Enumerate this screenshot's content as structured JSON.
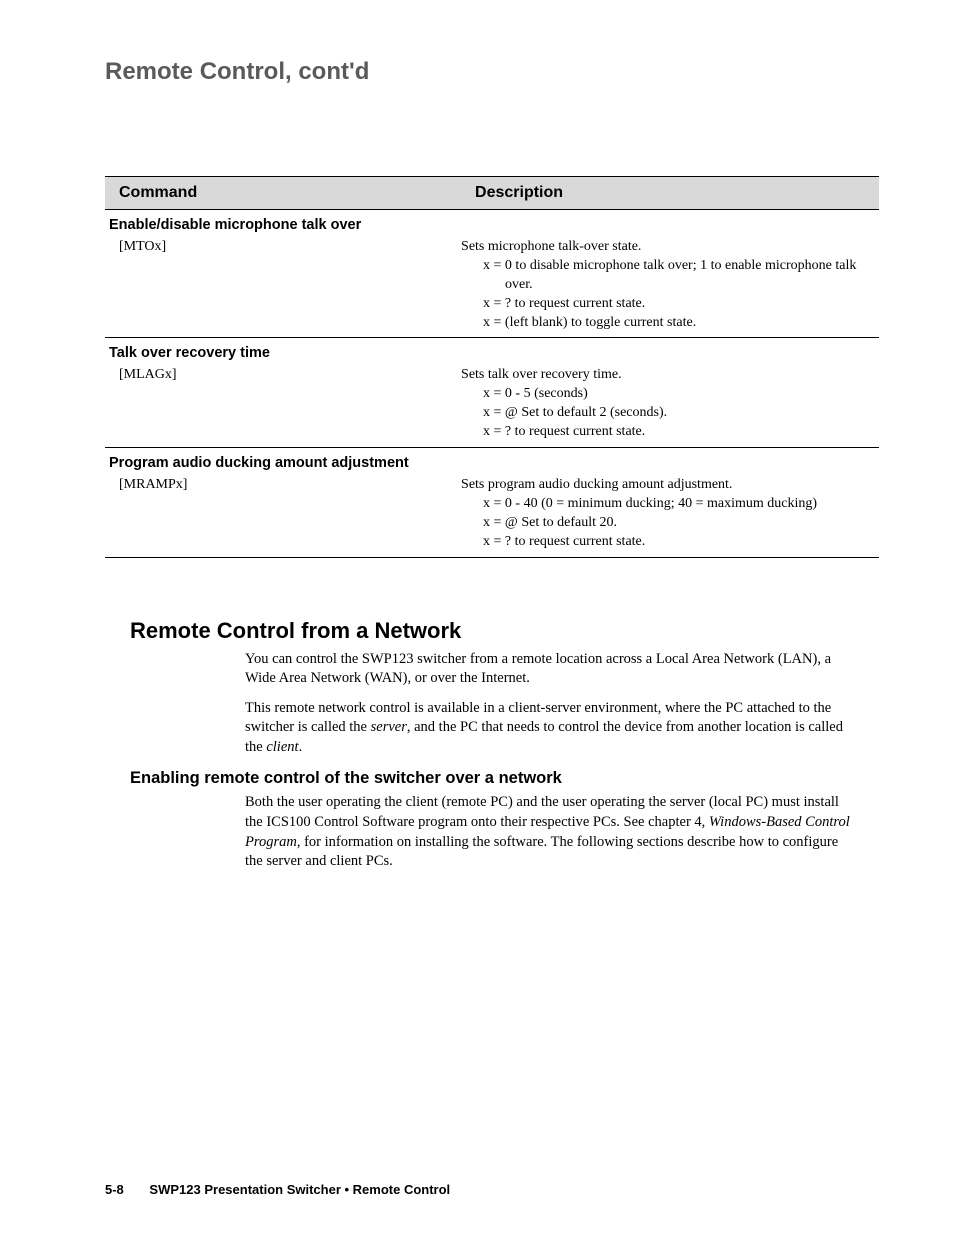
{
  "page_title": "Remote Control, cont'd",
  "table": {
    "headers": {
      "command": "Command",
      "description": "Description"
    },
    "sections": [
      {
        "title": "Enable/disable microphone talk over",
        "command": "[MTOx]",
        "desc_lead": "Sets microphone talk-over state.",
        "x_lines": [
          "x = 0 to disable microphone talk over; 1 to enable microphone talk over.",
          "x = ? to request current state.",
          "x = (left blank) to toggle current state."
        ]
      },
      {
        "title": "Talk over recovery time",
        "command": "[MLAGx]",
        "desc_lead": "Sets talk over recovery time.",
        "x_lines": [
          "x = 0 - 5 (seconds)",
          "x = @  Set to default 2 (seconds).",
          "x = ?   to request current state."
        ]
      },
      {
        "title": "Program audio ducking amount adjustment",
        "command": "[MRAMPx]",
        "desc_lead": "Sets program audio ducking amount adjustment.",
        "x_lines": [
          "x = 0 - 40  (0 = minimum ducking; 40 = maximum ducking)",
          "x = @  Set to default 20.",
          "x = ?   to request current state."
        ]
      }
    ]
  },
  "section1": {
    "heading": "Remote Control from a Network",
    "p1": "You can control the SWP123 switcher from a remote location across a Local Area Network (LAN), a Wide Area Network (WAN), or over the Internet.",
    "p2_a": "This remote network control is available in a client-server environment, where the PC attached to the switcher is called the ",
    "p2_server": "server",
    "p2_b": ", and the PC that needs to control the device from another location is called the ",
    "p2_client": "client",
    "p2_c": "."
  },
  "section2": {
    "heading": "Enabling remote control of the switcher over a network",
    "p_a": "Both the user operating the client (remote PC) and the user operating the server (local PC) must install the ICS100 Control Software program onto their respective PCs.  See chapter 4, ",
    "p_italic": "Windows-Based Control Program",
    "p_b": ", for information on installing the software.  The following sections describe how to configure the server and client PCs."
  },
  "footer": {
    "page": "5-8",
    "text": "SWP123 Presentation Switcher • Remote Control"
  }
}
